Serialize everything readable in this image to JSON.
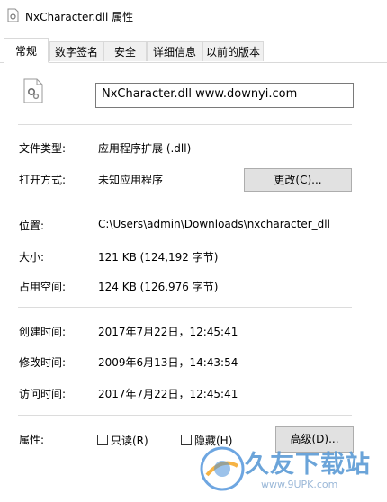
{
  "window": {
    "title": "NxCharacter.dll 属性"
  },
  "tabs": [
    {
      "label": "常规"
    },
    {
      "label": "数字签名"
    },
    {
      "label": "安全"
    },
    {
      "label": "详细信息"
    },
    {
      "label": "以前的版本"
    }
  ],
  "general": {
    "file_name": "NxCharacter.dll     www.downyi.com",
    "file_type_label": "文件类型:",
    "file_type_value": "应用程序扩展 (.dll)",
    "open_with_label": "打开方式:",
    "open_with_value": "未知应用程序",
    "change_button": "更改(C)...",
    "location_label": "位置:",
    "location_value": "C:\\Users\\admin\\Downloads\\nxcharacter_dll",
    "size_label": "大小:",
    "size_value": "121 KB (124,192 字节)",
    "size_on_disk_label": "占用空间:",
    "size_on_disk_value": "124 KB (126,976 字节)",
    "created_label": "创建时间:",
    "created_value": "2017年7月22日，12:45:41",
    "modified_label": "修改时间:",
    "modified_value": "2009年6月13日，14:43:54",
    "accessed_label": "访问时间:",
    "accessed_value": "2017年7月22日，12:45:41",
    "attributes_label": "属性:",
    "readonly_label": "只读(R)",
    "readonly_checked": false,
    "hidden_label": "隐藏(H)",
    "hidden_checked": false,
    "advanced_button": "高级(D)..."
  },
  "watermark": {
    "text": "久友下载站",
    "url": "www.9UPK.com"
  }
}
